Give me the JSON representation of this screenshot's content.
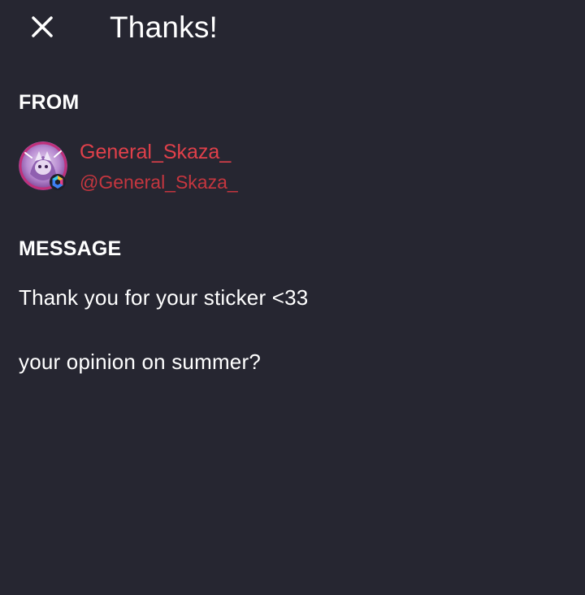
{
  "header": {
    "close_icon": "close-icon",
    "title": "Thanks!"
  },
  "from_section": {
    "label": "FROM",
    "sender": {
      "display_name": "General_Skaza_",
      "handle": "@General_Skaza_",
      "avatar_icon": "avatar",
      "badge_icon": "hexagon-badge-icon"
    }
  },
  "message_section": {
    "label": "MESSAGE",
    "lines": [
      "Thank you for your sticker <33",
      "your opinion on summer?"
    ]
  },
  "colors": {
    "background": "#262631",
    "accent_name": "#e0404a",
    "accent_handle": "#c5363f",
    "text": "#ffffff"
  }
}
